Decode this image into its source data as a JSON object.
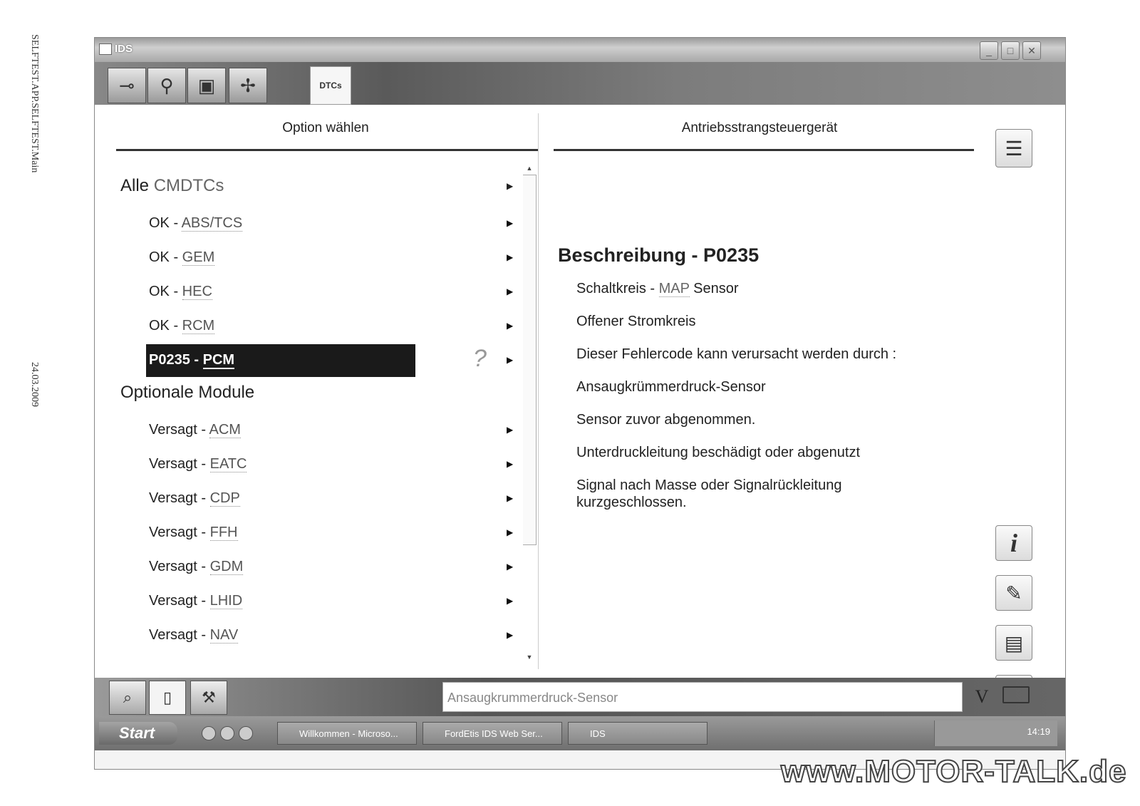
{
  "margin": {
    "doc_id": "SELFTEST.APP.SELFTEST.Main",
    "date": "24.03.2009"
  },
  "window": {
    "title": "IDS"
  },
  "toolbar": {
    "tabs": [
      {
        "name": "connect-icon"
      },
      {
        "name": "vehicle-icon"
      },
      {
        "name": "toolbox-icon"
      },
      {
        "name": "diagnostics-icon"
      }
    ],
    "active_tab": "DTCs"
  },
  "left_panel": {
    "header": "Option wählen",
    "groups": [
      {
        "prefix": "Alle",
        "abbr": "CMDTCs",
        "items": [
          {
            "status": "OK - ",
            "module": "ABS/TCS"
          },
          {
            "status": "OK - ",
            "module": "GEM"
          },
          {
            "status": "OK - ",
            "module": "HEC"
          },
          {
            "status": "OK - ",
            "module": "RCM"
          },
          {
            "status": "P0235 - ",
            "module": "PCM",
            "selected": true
          }
        ]
      },
      {
        "title": "Optionale Module",
        "items": [
          {
            "status": "Versagt - ",
            "module": "ACM"
          },
          {
            "status": "Versagt - ",
            "module": "EATC"
          },
          {
            "status": "Versagt - ",
            "module": "CDP"
          },
          {
            "status": "Versagt - ",
            "module": "FFH"
          },
          {
            "status": "Versagt - ",
            "module": "GDM"
          },
          {
            "status": "Versagt - ",
            "module": "LHID"
          },
          {
            "status": "Versagt - ",
            "module": "NAV"
          }
        ]
      }
    ]
  },
  "right_panel": {
    "header": "Antriebsstrangsteuergerät",
    "desc_title": "Beschreibung - P0235",
    "lines": {
      "l1_pre": "Schaltkreis - ",
      "l1_abbr": "MAP",
      "l1_post": " Sensor",
      "l2": "Offener Stromkreis",
      "l3": "Dieser Fehlercode kann verursacht werden durch :",
      "l4": "Ansaugkrümmerdruck-Sensor",
      "l5": "Sensor zuvor abgenommen.",
      "l6": "Unterdruckleitung beschädigt oder abgenutzt",
      "l7a": "Signal nach Masse oder Signalrückleitung",
      "l7b": "kurzgeschlossen."
    }
  },
  "statusbar": {
    "field_value": "Ansaugkrummerdruck-Sensor",
    "v_label": "V"
  },
  "taskbar": {
    "start": "Start",
    "tasks": [
      "Willkommen - Microso...",
      "FordEtis IDS Web Ser...",
      "IDS"
    ],
    "clock": "14:19"
  },
  "watermark": "www.MOTOR-TALK.de"
}
